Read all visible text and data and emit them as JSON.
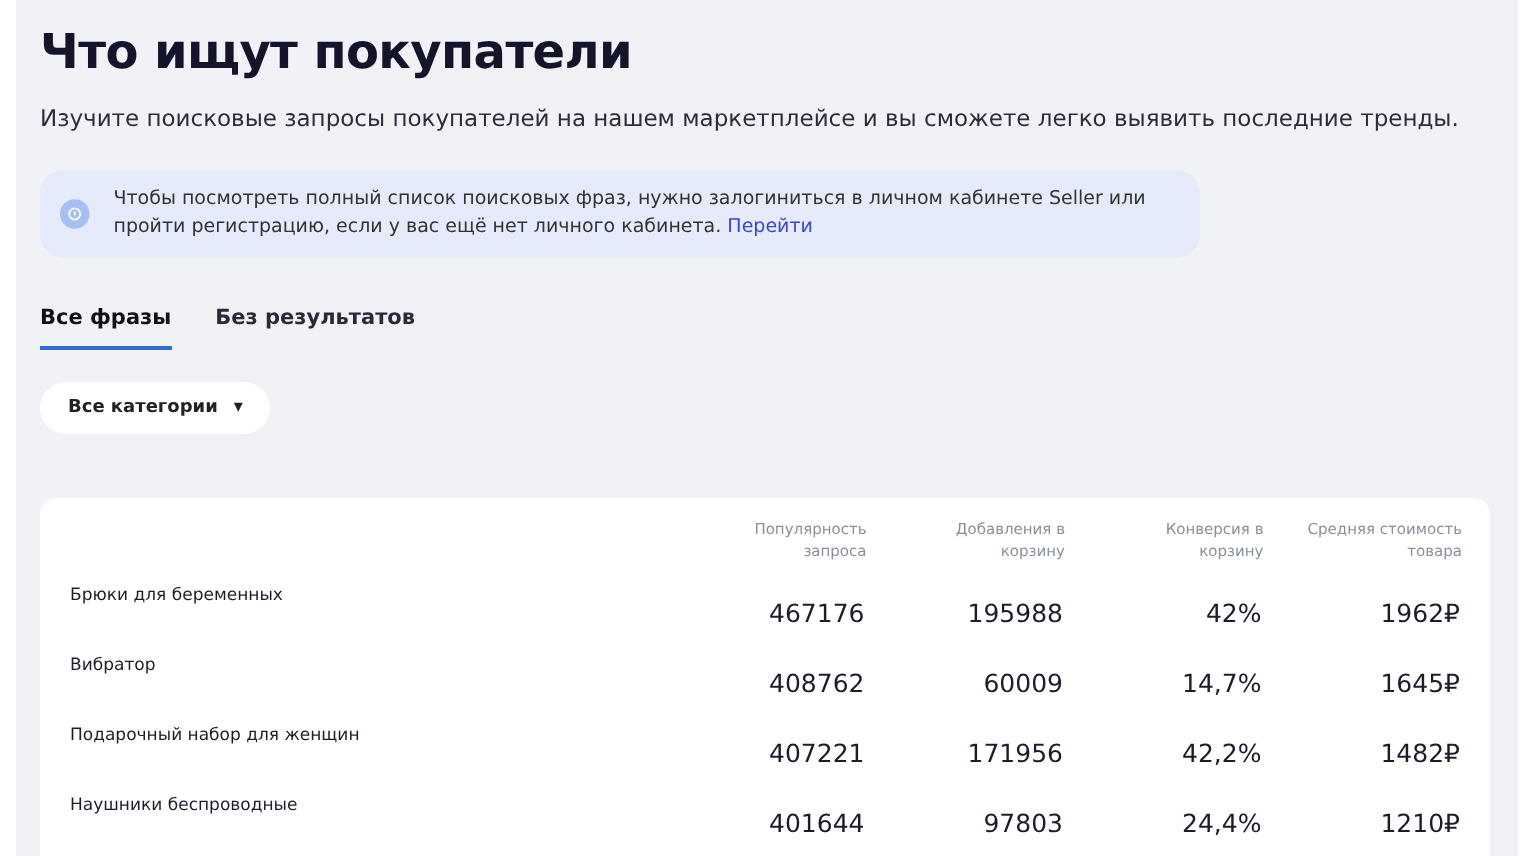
{
  "title": "Что ищут покупатели",
  "subtitle": "Изучите поисковые запросы покупателей на нашем маркетплейсе и вы сможете легко выявить последние тренды.",
  "notice": {
    "text": "Чтобы посмотреть полный список поисковых фраз, нужно залогиниться в личном кабинете Seller или пройти регистрацию, если у вас ещё нет личного кабинета.",
    "link": "Перейти"
  },
  "tabs": [
    {
      "label": "Все фразы",
      "selected": true
    },
    {
      "label": "Без результатов",
      "selected": false
    }
  ],
  "category_dropdown": {
    "value": "Все категории",
    "caret": "▾"
  },
  "table": {
    "columns": [
      "",
      "Популярность запроса",
      "Добавления в корзину",
      "Конверсия в корзину",
      "Средняя стоимость товара"
    ],
    "rows": [
      [
        "Брюки для беременных",
        "467176",
        "195988",
        "42%",
        "1962₽"
      ],
      [
        "Вибратор",
        "408762",
        "60009",
        "14,7%",
        "1645₽"
      ],
      [
        "Подарочный набор для женщин",
        "407221",
        "171956",
        "42,2%",
        "1482₽"
      ],
      [
        "Наушники беспроводные",
        "401644",
        "97803",
        "24,4%",
        "1210₽"
      ]
    ]
  }
}
